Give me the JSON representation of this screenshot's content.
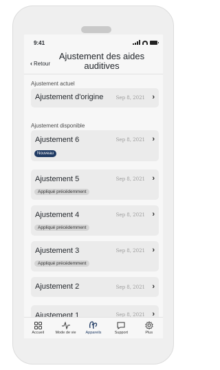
{
  "status_bar": {
    "time": "9:41"
  },
  "header": {
    "back_label": "Retour",
    "title": "Ajustement des aides auditives"
  },
  "sections": {
    "current_label": "Ajustement actuel",
    "available_label": "Ajustement disponible"
  },
  "current_fitting": {
    "name": "Ajustement d'origine",
    "date": "Sep 8, 2021"
  },
  "available_fittings": [
    {
      "name": "Ajustement 6",
      "date": "Sep 8, 2021",
      "badge": "Nouveau"
    },
    {
      "name": "Ajustement 5",
      "date": "Sep 8, 2021",
      "badge": "Appliqué précédemment"
    },
    {
      "name": "Ajustement 4",
      "date": "Sep 8, 2021",
      "badge": "Appliqué précédemment"
    },
    {
      "name": "Ajustement 3",
      "date": "Sep 8, 2021",
      "badge": "Appliqué précédemment"
    },
    {
      "name": "Ajustement 2",
      "date": "Sep 8, 2021"
    },
    {
      "name": "Ajustement 1",
      "date": "Sep 8, 2021"
    }
  ],
  "tabbar": {
    "items": [
      {
        "label": "Accueil",
        "icon": "home-grid-icon"
      },
      {
        "label": "Mode de vie",
        "icon": "activity-icon"
      },
      {
        "label": "Appareils",
        "icon": "hearing-aids-icon",
        "active": true
      },
      {
        "label": "Support",
        "icon": "chat-bubble-icon"
      },
      {
        "label": "Plus",
        "icon": "gear-icon"
      }
    ]
  },
  "colors": {
    "accent": "#1f3a63",
    "background": "#f7f7f7",
    "card": "#ebebeb"
  }
}
